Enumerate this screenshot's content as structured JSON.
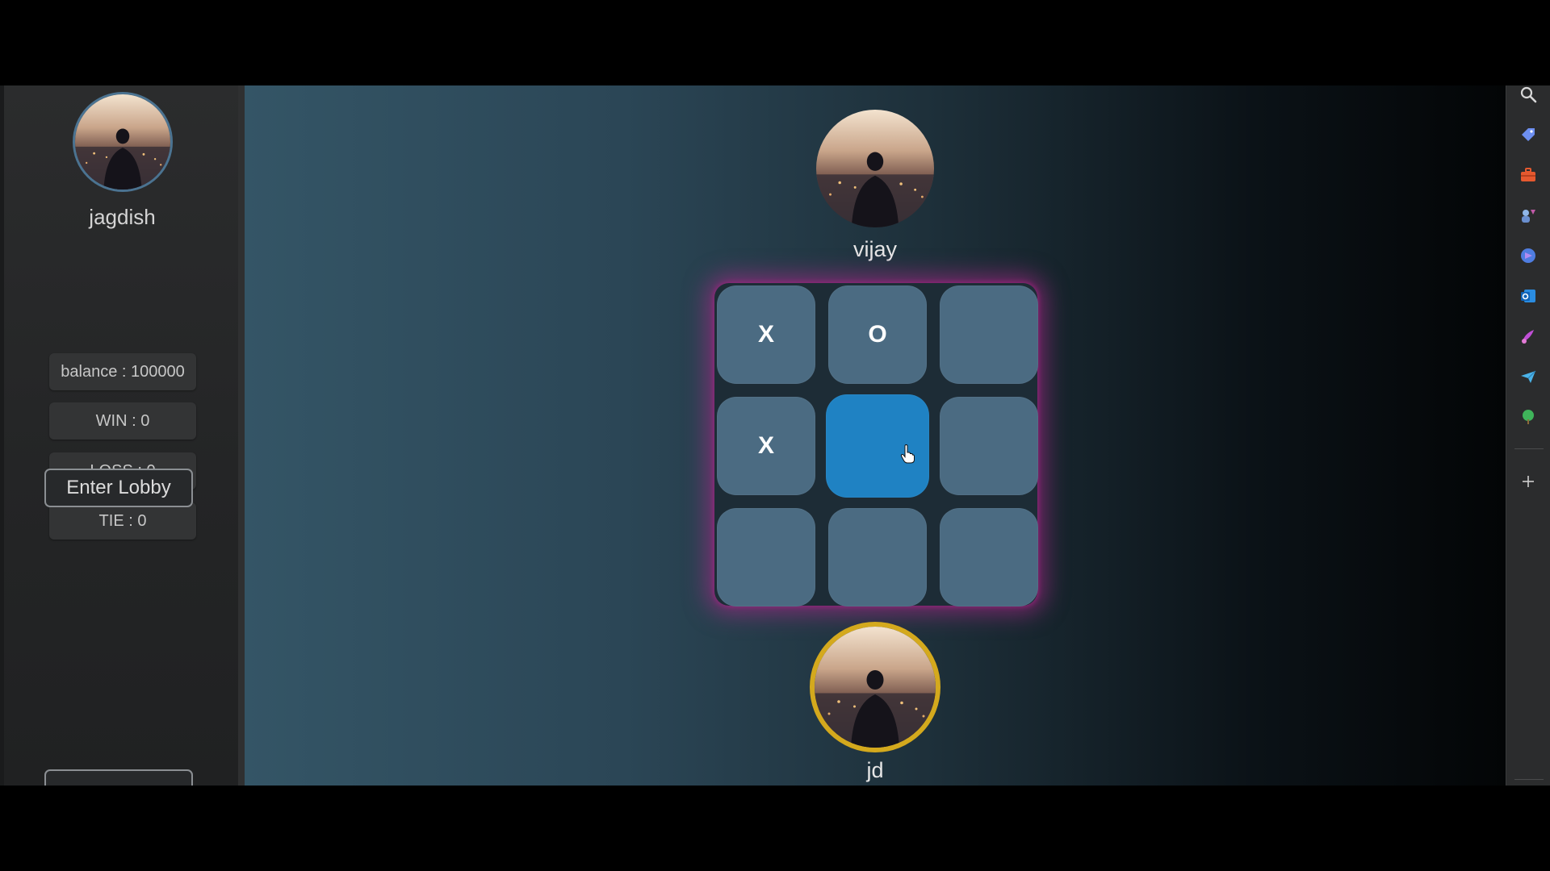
{
  "sidebar": {
    "username": "jagdish",
    "stats": {
      "balance": "balance : 100000",
      "win": "WIN : 0",
      "loss": "LOSS : 0",
      "tie": "TIE : 0"
    },
    "enter_lobby_label": "Enter Lobby"
  },
  "game": {
    "opponent_name": "vijay",
    "player_name": "jd",
    "board": [
      "X",
      "O",
      "",
      "X",
      "",
      "",
      "",
      "",
      ""
    ],
    "hovered_cell": 4,
    "active_player": "jd"
  },
  "colors": {
    "board_glow": "#be2896",
    "cell": "#4b6b82",
    "cell_hover": "#1f82c3",
    "turn_ring": "#d4a91d"
  },
  "right_toolbar": {
    "icons": [
      "search-icon",
      "tag-icon",
      "briefcase-icon",
      "games-icon",
      "copilot-icon",
      "outlook-icon",
      "designer-icon",
      "send-icon",
      "tree-icon",
      "add-icon"
    ]
  }
}
